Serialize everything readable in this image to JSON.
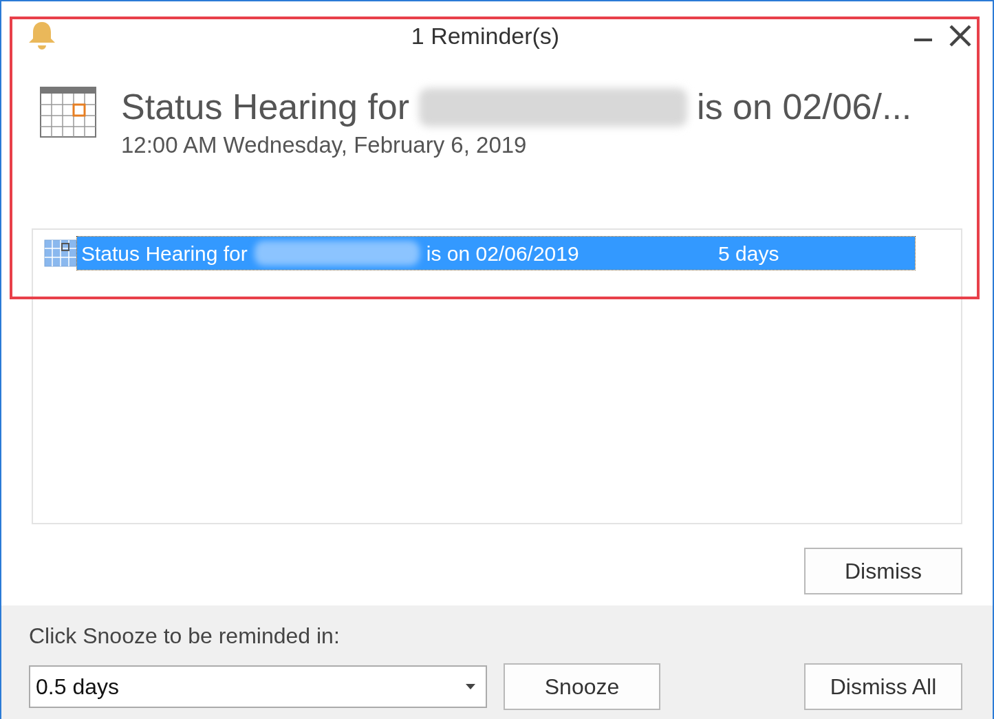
{
  "window": {
    "title": "1 Reminder(s)"
  },
  "header": {
    "subject_start": "Status Hearing for",
    "subject_end": "is on 02/06/...",
    "time": "12:00 AM Wednesday, February 6, 2019"
  },
  "reminders": [
    {
      "subject_start": "Status Hearing for",
      "subject_end": "is on 02/06/2019",
      "due_in": "5 days",
      "selected": true
    }
  ],
  "buttons": {
    "dismiss": "Dismiss",
    "snooze": "Snooze",
    "dismiss_all": "Dismiss All"
  },
  "snooze": {
    "label": "Click Snooze to be reminded in:",
    "value": "0.5 days"
  }
}
